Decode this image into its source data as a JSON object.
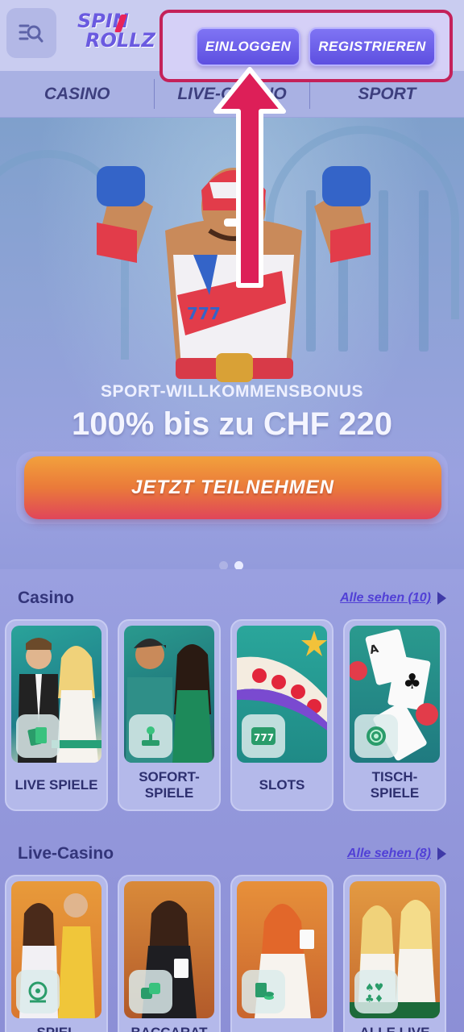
{
  "header": {
    "logo_line1": "SPIN",
    "logo_line2": "ROLLZ",
    "login_label": "EINLOGGEN",
    "register_label": "REGISTRIEREN"
  },
  "nav": {
    "items": [
      "CASINO",
      "LIVE-CASINO",
      "SPORT"
    ]
  },
  "hero": {
    "subtitle": "SPORT-WILLKOMMENSBONUS",
    "title": "100% bis zu CHF 220",
    "cta_label": "JETZT TEILNEHMEN",
    "slides": 2,
    "active_slide": 2
  },
  "casino_section": {
    "title": "Casino",
    "see_all": "Alle sehen (10)",
    "cards": [
      {
        "label": "LIVE SPIELE",
        "icon": "cards-icon"
      },
      {
        "label": "SOFORT-\nSPIELE",
        "icon": "joystick-icon"
      },
      {
        "label": "SLOTS",
        "icon": "slot-777-icon"
      },
      {
        "label": "TISCH-\nSPIELE",
        "icon": "chip-icon"
      }
    ]
  },
  "live_section": {
    "title": "Live-Casino",
    "see_all": "Alle sehen (8)",
    "cards": [
      {
        "label": "SPIEL",
        "icon": "wheel-icon"
      },
      {
        "label": "BACCARAT",
        "icon": "dice-icon"
      },
      {
        "label": "",
        "icon": "chips-stack-icon"
      },
      {
        "label": "ALLE LIVE",
        "icon": "card-suits-icon"
      }
    ]
  },
  "colors": {
    "accent": "#6a5ae0",
    "highlight_border": "#c4215a",
    "cta_gradient_top": "#f2a13c",
    "cta_gradient_bottom": "#e0455a"
  }
}
